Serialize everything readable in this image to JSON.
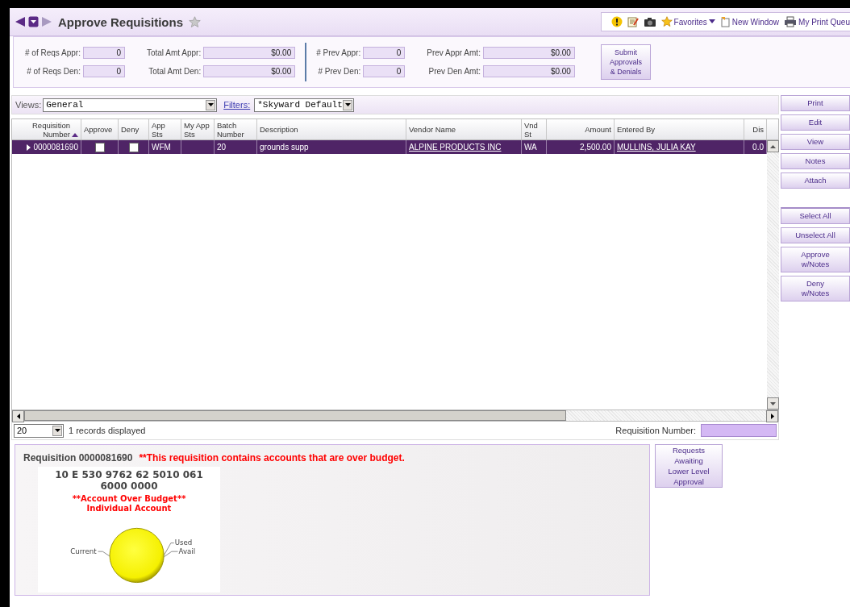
{
  "header": {
    "title": "Approve Requisitions",
    "favorites": "Favorites",
    "new_window": "New Window",
    "print_queue": "My Print Queu"
  },
  "totals": {
    "groups": [
      {
        "fields": [
          {
            "label": "# of Reqs Appr:",
            "value": "0",
            "kind": "count"
          },
          {
            "label": "Total Amt Appr:",
            "value": "$0.00",
            "kind": "amount"
          },
          {
            "label": "# of Reqs Den:",
            "value": "0",
            "kind": "count"
          },
          {
            "label": "Total Amt Den:",
            "value": "$0.00",
            "kind": "amount"
          }
        ]
      },
      {
        "fields": [
          {
            "label": "# Prev Appr:",
            "value": "0",
            "kind": "count"
          },
          {
            "label": "Prev Appr Amt:",
            "value": "$0.00",
            "kind": "amount"
          },
          {
            "label": "# Prev Den:",
            "value": "0",
            "kind": "count"
          },
          {
            "label": "Prev Den Amt:",
            "value": "$0.00",
            "kind": "amount"
          }
        ]
      }
    ],
    "submit": "Submit Approvals & Denials"
  },
  "views": {
    "label": "Views:",
    "value": "General",
    "filters_label": "Filters:",
    "filters_value": "*Skyward Default"
  },
  "table": {
    "columns": [
      {
        "label": "Requisition Number",
        "kind": "number",
        "sorted": true
      },
      {
        "label": "Approve",
        "kind": "check",
        "sorted": false
      },
      {
        "label": "Deny",
        "kind": "check",
        "sorted": false
      },
      {
        "label": "App Sts",
        "kind": "text",
        "sorted": false
      },
      {
        "label": "My App Sts",
        "kind": "text",
        "sorted": false
      },
      {
        "label": "Batch Number",
        "kind": "text",
        "sorted": false
      },
      {
        "label": "Description",
        "kind": "text",
        "sorted": false
      },
      {
        "label": "Vendor Name",
        "kind": "link",
        "sorted": false
      },
      {
        "label": "Vnd St",
        "kind": "text",
        "sorted": false
      },
      {
        "label": "Amount",
        "kind": "number",
        "sorted": false
      },
      {
        "label": "Entered By",
        "kind": "link",
        "sorted": false
      },
      {
        "label": "Dis",
        "kind": "number",
        "sorted": false
      }
    ],
    "rows": [
      {
        "selected": true,
        "cells": [
          {
            "text": "0000081690"
          },
          {
            "checked": false
          },
          {
            "checked": false
          },
          {
            "text": "WFM"
          },
          {
            "text": ""
          },
          {
            "text": "20"
          },
          {
            "text": "grounds supp"
          },
          {
            "text": "ALPINE PRODUCTS INC"
          },
          {
            "text": "WA"
          },
          {
            "text": "2,500.00"
          },
          {
            "text": "MULLINS, JULIA KAY"
          },
          {
            "text": "0.0"
          }
        ]
      }
    ]
  },
  "side_buttons": [
    {
      "label": "Print",
      "gap_before": false
    },
    {
      "label": "Edit",
      "gap_before": false
    },
    {
      "label": "View",
      "gap_before": false
    },
    {
      "label": "Notes",
      "gap_before": false
    },
    {
      "label": "Attach",
      "gap_before": false
    },
    {
      "label": "Select All",
      "gap_before": true
    },
    {
      "label": "Unselect All",
      "gap_before": false
    },
    {
      "label": "Approve w/Notes",
      "gap_before": false
    },
    {
      "label": "Deny w/Notes",
      "gap_before": false
    }
  ],
  "footer": {
    "page_size": "20",
    "records": "1 records displayed",
    "req_label": "Requisition Number:"
  },
  "detail": {
    "title": "Requisition 0000081690",
    "warning": "**This requisition contains accounts that are over budget.",
    "account_lines": [
      "10 E 530 9762 62 5010 061",
      "6000 0000"
    ],
    "budget_lines": [
      "**Account Over Budget**",
      "Individual Account"
    ],
    "chart_labels": {
      "left": "Current",
      "top": "Used",
      "right": "Avail"
    }
  },
  "lower_button": "Requests Awaiting Lower Level Approval"
}
